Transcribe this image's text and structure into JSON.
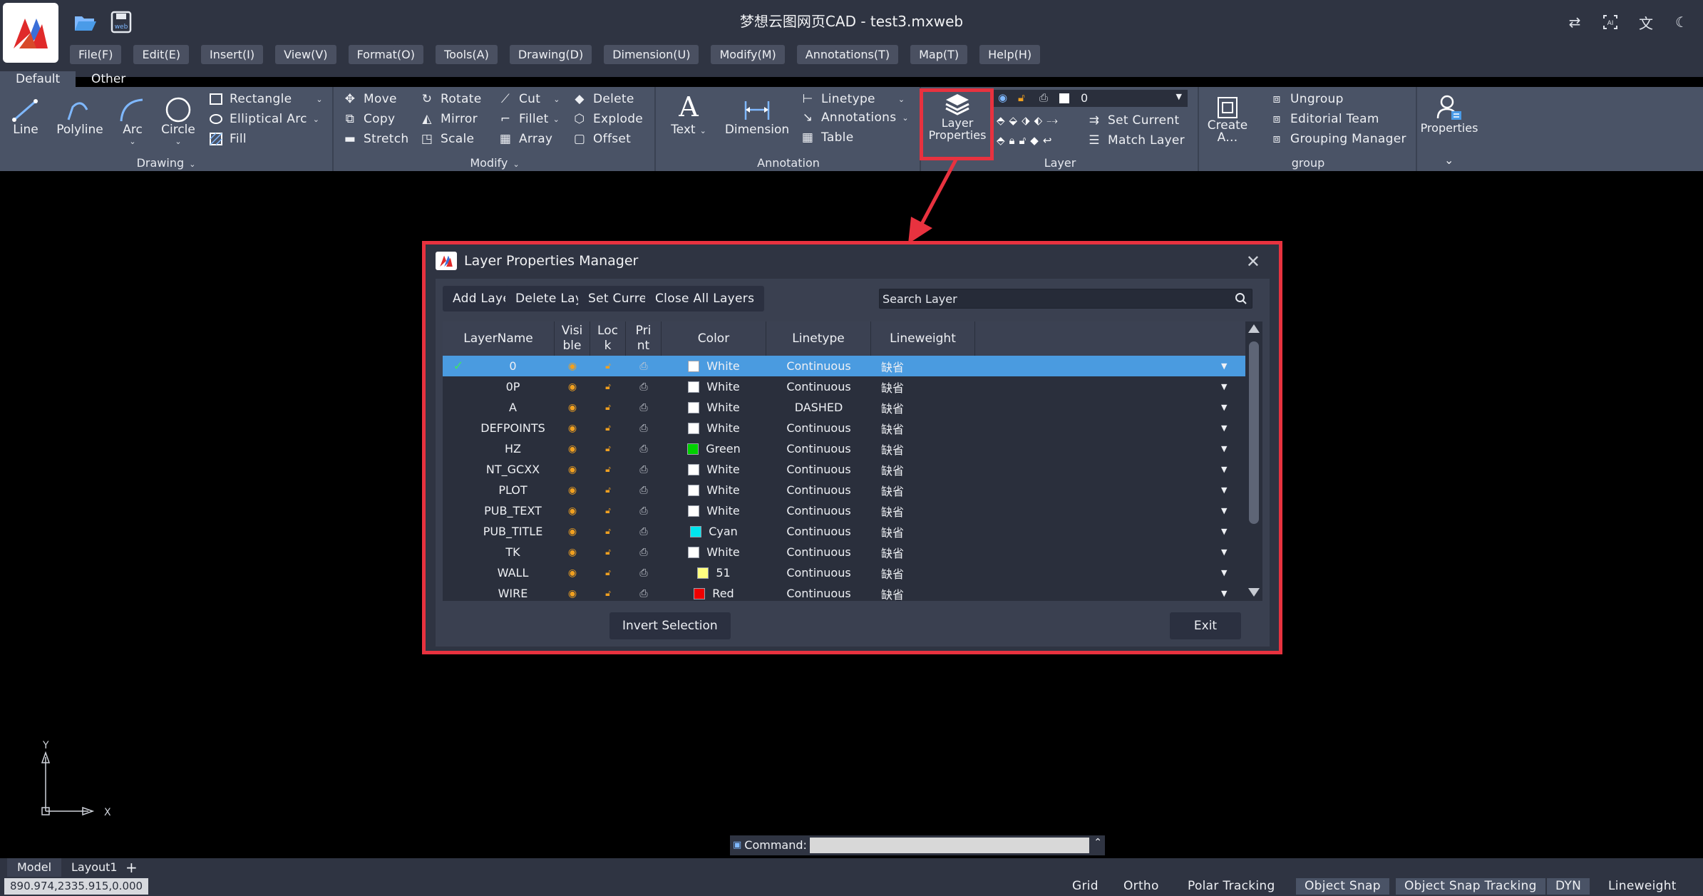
{
  "window": {
    "title": "梦想云图网页CAD - test3.mxweb"
  },
  "topbar": {
    "open_icon": "folder-open-icon",
    "save_icon": "save-web-icon",
    "right_icons": [
      "swap-icon",
      "ai-icon",
      "translate-icon",
      "dark-mode-icon"
    ]
  },
  "menu": [
    "File(F)",
    "Edit(E)",
    "Insert(I)",
    "View(V)",
    "Format(O)",
    "Tools(A)",
    "Drawing(D)",
    "Dimension(U)",
    "Modify(M)",
    "Annotations(T)",
    "Map(T)",
    "Help(H)"
  ],
  "ribbon": {
    "tabs": [
      "Default",
      "Other"
    ],
    "drawing": {
      "title": "Drawing",
      "big_tools": [
        "Line",
        "Polyline",
        "Arc",
        "Circle"
      ],
      "small_tools": [
        "Rectangle",
        "Elliptical Arc",
        "Fill"
      ]
    },
    "modify": {
      "title": "Modify",
      "tools": [
        "Move",
        "Rotate",
        "Cut",
        "Delete",
        "Copy",
        "Mirror",
        "Fillet",
        "Explode",
        "Stretch",
        "Scale",
        "Array",
        "Offset"
      ]
    },
    "annotation": {
      "title": "Annotation",
      "text": "Text",
      "dimension": "Dimension",
      "small_tools": [
        "Linetype",
        "Annotations",
        "Table"
      ]
    },
    "layer": {
      "title": "Layer",
      "layer_properties": "Layer Properties",
      "current_layer": "0",
      "set_current": "Set Current",
      "match_layer": "Match Layer"
    },
    "group": {
      "title": "group",
      "create": "Create A…",
      "tools": [
        "Ungroup",
        "Editorial Team",
        "Grouping Manager"
      ]
    },
    "properties": {
      "label": "Properties"
    }
  },
  "dialog": {
    "title": "Layer Properties Manager",
    "buttons": {
      "add": "Add Layer",
      "delete": "Delete Layer",
      "set_current": "Set Current",
      "close_all": "Close All Layers"
    },
    "search_placeholder": "Search Layer",
    "columns": {
      "name": "LayerName",
      "visible": "Visi\nble",
      "lock": "Loc\nk",
      "print": "Pri\nnt",
      "color": "Color",
      "linetype": "Linetype",
      "lineweight": "Lineweight"
    },
    "rows": [
      {
        "name": "0",
        "color": "White",
        "swatch": "#ffffff",
        "linetype": "Continuous",
        "lineweight": "缺省",
        "current": true
      },
      {
        "name": "0P",
        "color": "White",
        "swatch": "#ffffff",
        "linetype": "Continuous",
        "lineweight": "缺省"
      },
      {
        "name": "A",
        "color": "White",
        "swatch": "#ffffff",
        "linetype": "DASHED",
        "lineweight": "缺省"
      },
      {
        "name": "DEFPOINTS",
        "color": "White",
        "swatch": "#ffffff",
        "linetype": "Continuous",
        "lineweight": "缺省"
      },
      {
        "name": "HZ",
        "color": "Green",
        "swatch": "#00d000",
        "linetype": "Continuous",
        "lineweight": "缺省"
      },
      {
        "name": "NT_GCXX",
        "color": "White",
        "swatch": "#ffffff",
        "linetype": "Continuous",
        "lineweight": "缺省"
      },
      {
        "name": "PLOT",
        "color": "White",
        "swatch": "#ffffff",
        "linetype": "Continuous",
        "lineweight": "缺省"
      },
      {
        "name": "PUB_TEXT",
        "color": "White",
        "swatch": "#ffffff",
        "linetype": "Continuous",
        "lineweight": "缺省"
      },
      {
        "name": "PUB_TITLE",
        "color": "Cyan",
        "swatch": "#00e5ee",
        "linetype": "Continuous",
        "lineweight": "缺省"
      },
      {
        "name": "TK",
        "color": "White",
        "swatch": "#ffffff",
        "linetype": "Continuous",
        "lineweight": "缺省"
      },
      {
        "name": "WALL",
        "color": "51",
        "swatch": "#ffff80",
        "linetype": "Continuous",
        "lineweight": "缺省"
      },
      {
        "name": "WIRE",
        "color": "Red",
        "swatch": "#ee0000",
        "linetype": "Continuous",
        "lineweight": "缺省"
      }
    ],
    "invert_selection": "Invert Selection",
    "exit": "Exit"
  },
  "canvas": {
    "ucs_x": "X",
    "ucs_y": "Y"
  },
  "command": {
    "label": "Command:",
    "value": ""
  },
  "layout_tabs": [
    "Model",
    "Layout1"
  ],
  "add_layout": "+",
  "status": {
    "coords": "890.974,2335.915,0.000",
    "buttons": [
      {
        "label": "Grid",
        "on": false
      },
      {
        "label": "Ortho",
        "on": false
      },
      {
        "label": "Polar Tracking",
        "on": false
      },
      {
        "label": "Object Snap",
        "on": true
      },
      {
        "label": "Object Snap Tracking",
        "on": true
      },
      {
        "label": "DYN",
        "on": true
      },
      {
        "label": "Lineweight",
        "on": false
      }
    ]
  },
  "colors": {
    "accent_red": "#e8323f",
    "selected_row": "#4a9be0",
    "icon_orange": "#f0a020"
  }
}
